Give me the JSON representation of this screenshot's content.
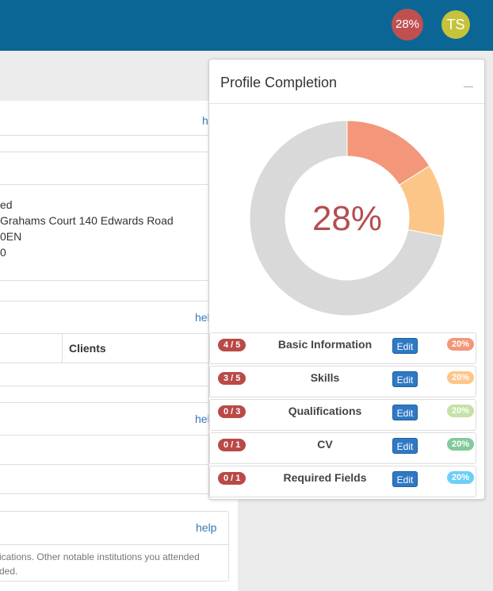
{
  "header": {
    "completion_badge": "28%",
    "avatar_initials": "TS"
  },
  "background_panel": {
    "help_links": [
      "help",
      "help",
      "help",
      "help"
    ],
    "address_lines": [
      "ed",
      "Grahams Court 140 Edwards Road",
      "0EN",
      "0"
    ],
    "clients_header": "Clients",
    "education_help": "help",
    "education_text": [
      "ications. Other notable institutions you attended",
      "ded."
    ]
  },
  "profile_completion": {
    "title": "Profile Completion",
    "center_label": "28%",
    "sections": [
      {
        "count": "4 / 5",
        "label": "Basic Information",
        "edit": "Edit",
        "weight": "20%",
        "color": "#f4967a"
      },
      {
        "count": "3 / 5",
        "label": "Skills",
        "edit": "Edit",
        "weight": "20%",
        "color": "#fdc689"
      },
      {
        "count": "0 / 3",
        "label": "Qualifications",
        "edit": "Edit",
        "weight": "20%",
        "color": "#c5e1a5"
      },
      {
        "count": "0 / 1",
        "label": "CV",
        "edit": "Edit",
        "weight": "20%",
        "color": "#82ca9c"
      },
      {
        "count": "0 / 1",
        "label": "Required Fields",
        "edit": "Edit",
        "weight": "20%",
        "color": "#6dcff6"
      }
    ],
    "donut_segments": [
      {
        "section": "Basic Information",
        "value": 16,
        "color": "#f4967a"
      },
      {
        "section": "Skills",
        "value": 12,
        "color": "#fdc689"
      },
      {
        "section": "remaining",
        "value": 72,
        "color": "#d9d9d9"
      }
    ]
  },
  "colors": {
    "topbar": "#0b6695",
    "badge": "#c0504f",
    "avatar": "#c6c23a",
    "count_pill": "#b94a48",
    "edit_button": "#2f79c4",
    "center_text": "#b54d4f"
  }
}
